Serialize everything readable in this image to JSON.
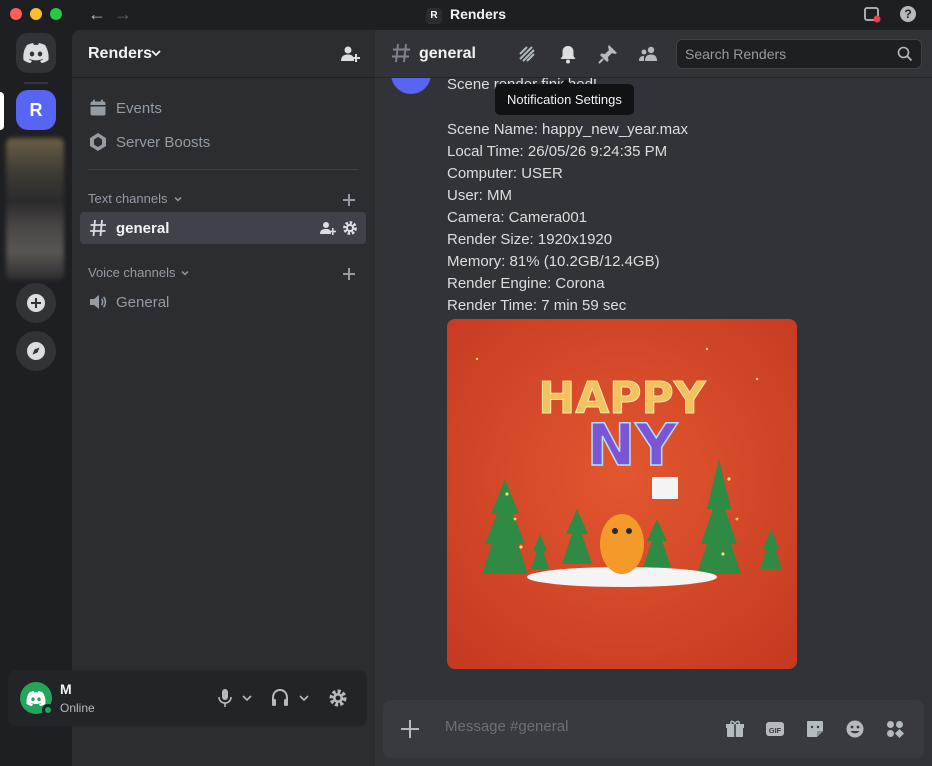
{
  "window": {
    "title": "Renders",
    "server_initial": "R"
  },
  "rail": {
    "home_label": "Direct Messages",
    "server_initial": "R"
  },
  "sidebar": {
    "server_name": "Renders",
    "items": [
      {
        "label": "Events",
        "icon": "calendar-icon"
      },
      {
        "label": "Server Boosts",
        "icon": "boost-icon"
      }
    ],
    "text_category": "Text channels",
    "voice_category": "Voice channels",
    "text_channels": [
      {
        "label": "general"
      }
    ],
    "voice_channels": [
      {
        "label": "General"
      }
    ]
  },
  "user": {
    "initial": "M",
    "name": "M",
    "status": "Online",
    "status_color": "#23a55a"
  },
  "channel": {
    "name": "general",
    "search_placeholder": "Search Renders",
    "tooltip": "Notification Settings"
  },
  "message": {
    "first_line": "Scene render finished!",
    "details": [
      "Scene Name: happy_new_year.max",
      "Local Time: 26/05/26 9:24:35 PM",
      "Computer: USER",
      "User: MM",
      "Camera: Camera001",
      "Render Size: 1920x1920",
      "Memory: 81% (10.2GB/12.4GB)",
      "Render Engine: Corona",
      "Render Time: 7 min 59 sec"
    ],
    "image": {
      "row1": "HAPPY",
      "row2": "NY"
    }
  },
  "composer": {
    "placeholder": "Message #general"
  },
  "colors": {
    "accent": "#5865f2",
    "online": "#23a55a",
    "image_bg": "#d94a2b"
  }
}
